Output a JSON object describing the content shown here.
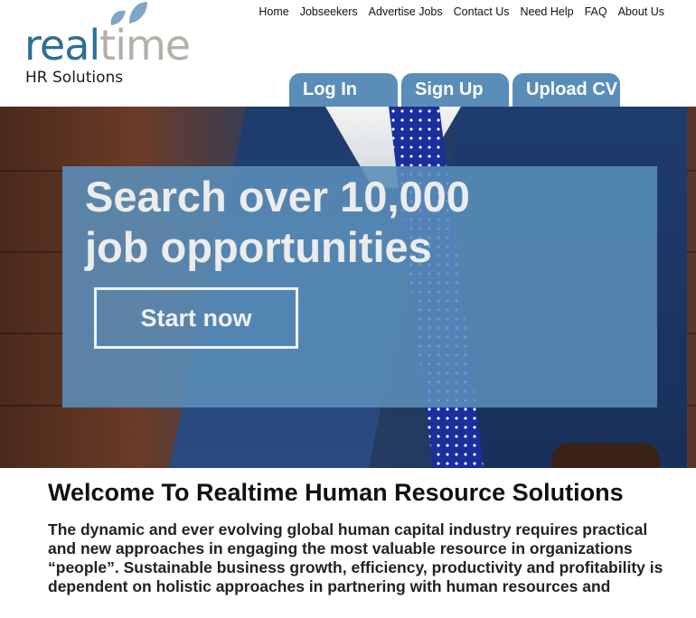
{
  "brand": {
    "logo_part1": "real",
    "logo_part2": "time",
    "tagline": "HR Solutions",
    "leaf_color": "#7fa6c4"
  },
  "topnav": {
    "items": [
      "Home",
      "Jobseekers",
      "Advertise Jobs",
      "Contact Us",
      "Need Help",
      "FAQ",
      "About Us"
    ]
  },
  "tabs": {
    "login": "Log In",
    "signup": "Sign Up",
    "upload": "Upload CV"
  },
  "hero": {
    "headline_line1": "Search over 10,000",
    "headline_line2": "job opportunities",
    "cta": "Start now"
  },
  "content": {
    "title": "Welcome To Realtime Human Resource Solutions",
    "intro": "The dynamic and ever evolving global human capital industry requires practical and new approaches in engaging the most valuable resource in organizations “people”. Sustainable business growth, efficiency, productivity and profitability is dependent on holistic approaches in partnering with human resources and"
  },
  "colors": {
    "brand_blue": "#2e6f95",
    "brand_gray": "#b4b0a8",
    "tab_blue": "#5a8db8",
    "overlay_blue": "#5a8eba"
  },
  "icons": [
    "leaf-icon"
  ]
}
